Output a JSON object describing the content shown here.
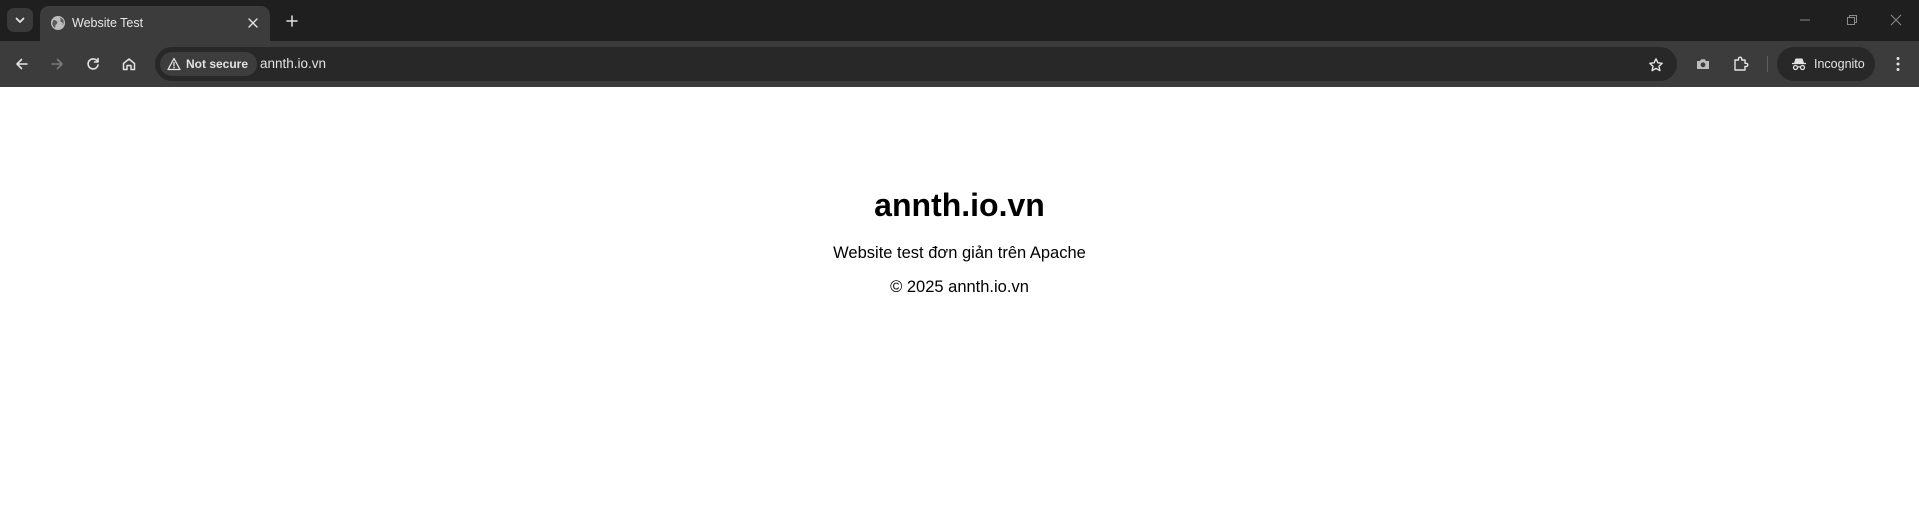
{
  "browser": {
    "tab": {
      "title": "Website Test"
    },
    "omnibox": {
      "security_label": "Not secure",
      "url": "annth.io.vn"
    },
    "profile_label": "Incognito",
    "icons": [
      "tab-search-icon",
      "globe-icon",
      "close-icon",
      "plus-icon",
      "minimize-icon",
      "restore-icon",
      "window-close-icon",
      "back-arrow-icon",
      "forward-arrow-icon",
      "reload-icon",
      "home-icon",
      "warning-icon",
      "star-icon",
      "camera-icon",
      "extensions-icon",
      "incognito-icon",
      "kebab-menu-icon"
    ]
  },
  "page": {
    "heading": "annth.io.vn",
    "description": "Website test đơn giản trên Apache",
    "footer": "© 2025 annth.io.vn"
  },
  "colors": {
    "tabstrip_bg": "#1f1f1f",
    "toolbar_bg": "#3c3c3c",
    "omnibox_bg": "#282828",
    "page_bg": "#ffffff",
    "text": "#000000"
  }
}
